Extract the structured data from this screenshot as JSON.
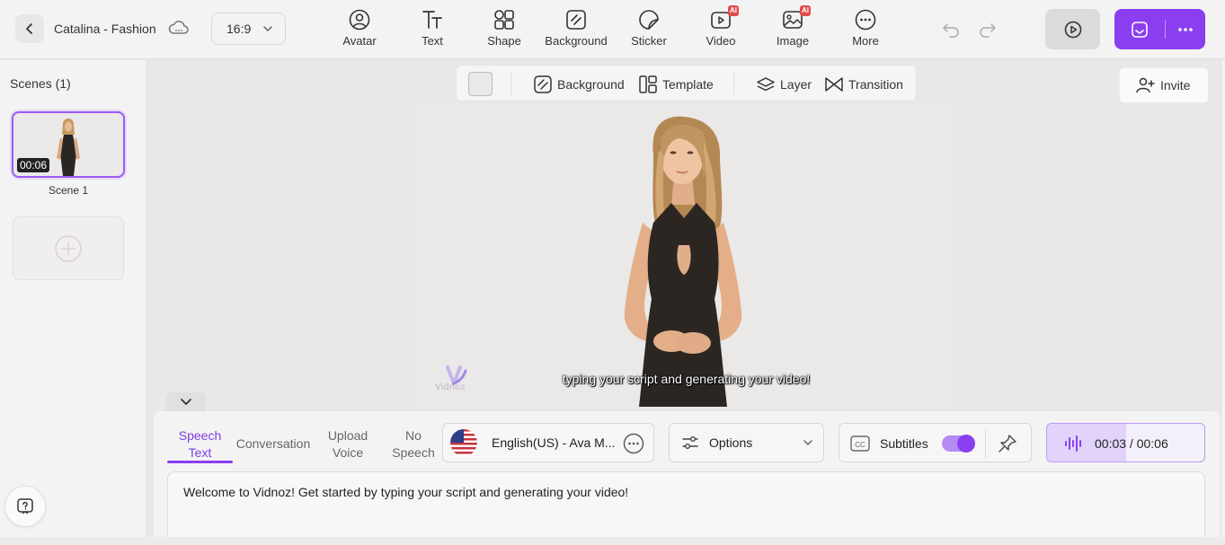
{
  "header": {
    "project_title": "Catalina - Fashion",
    "aspect_ratio": "16:9",
    "tools": [
      {
        "id": "avatar",
        "label": "Avatar",
        "icon": "avatar-icon"
      },
      {
        "id": "text",
        "label": "Text",
        "icon": "text-icon"
      },
      {
        "id": "shape",
        "label": "Shape",
        "icon": "shape-icon"
      },
      {
        "id": "background",
        "label": "Background",
        "icon": "background-icon"
      },
      {
        "id": "sticker",
        "label": "Sticker",
        "icon": "sticker-icon"
      },
      {
        "id": "video",
        "label": "Video",
        "icon": "video-icon",
        "badge": "AI"
      },
      {
        "id": "image",
        "label": "Image",
        "icon": "image-icon",
        "badge": "AI"
      },
      {
        "id": "more",
        "label": "More",
        "icon": "more-icon"
      }
    ]
  },
  "sidebar": {
    "scenes_title": "Scenes (1)",
    "scenes": [
      {
        "label": "Scene 1",
        "duration": "00:06"
      }
    ]
  },
  "canvas_toolbar": {
    "background_label": "Background",
    "template_label": "Template",
    "layer_label": "Layer",
    "transition_label": "Transition"
  },
  "invite_label": "Invite",
  "canvas": {
    "subtitle": "typing your script and generating your video!",
    "watermark": "Vidnoz"
  },
  "script_panel": {
    "tabs": [
      {
        "line1": "Speech",
        "line2": "Text",
        "active": true
      },
      {
        "line1": "Conversation",
        "line2": "",
        "active": false
      },
      {
        "line1": "Upload",
        "line2": "Voice",
        "active": false
      },
      {
        "line1": "No",
        "line2": "Speech",
        "active": false
      }
    ],
    "voice": "English(US) - Ava M...",
    "options_label": "Options",
    "subtitles_label": "Subtitles",
    "subtitles_on": true,
    "audio_time": "00:03 / 00:06",
    "audio_progress": 0.5,
    "script_text": "Welcome to Vidnoz! Get started by typing your script and generating your video!"
  },
  "colors": {
    "accent": "#8a3ef0",
    "accent_light": "#e2d3fa",
    "badge": "#e34a4a"
  }
}
